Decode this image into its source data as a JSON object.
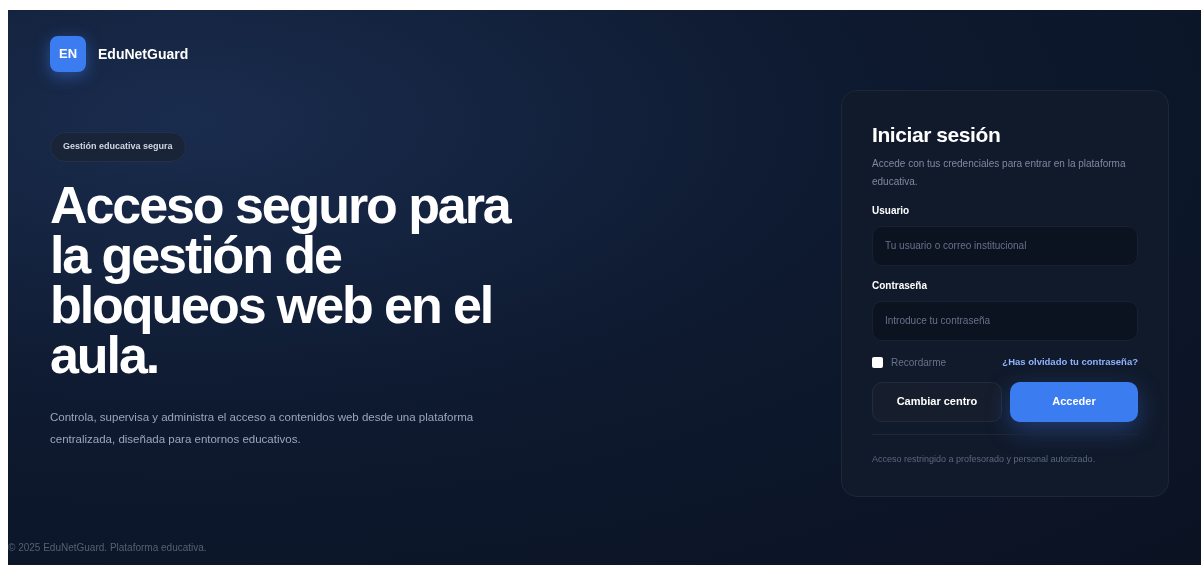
{
  "brand": {
    "logo": "EN",
    "name": "EduNetGuard"
  },
  "hero": {
    "badge": "Gestión educativa segura",
    "headline": "Acceso seguro para la gestión de bloqueos web en el aula.",
    "description": "Controla, supervisa y administra el acceso a contenidos web desde una plataforma centralizada, diseñada para entornos educativos."
  },
  "footer": "© 2025 EduNetGuard. Plataforma educativa.",
  "login": {
    "title": "Iniciar sesión",
    "subtitle": "Accede con tus credenciales para entrar en la plataforma educativa.",
    "fields": [
      {
        "label": "Usuario",
        "placeholder": "Tu usuario o correo institucional"
      },
      {
        "label": "Contraseña",
        "placeholder": "Introduce tu contraseña"
      }
    ],
    "remember": {
      "label": "Recordarme",
      "checked": false
    },
    "forgot_link": "¿Has olvidado tu contraseña?",
    "buttons": [
      {
        "label": "Cambiar centro",
        "kind": "secondary"
      },
      {
        "label": "Acceder",
        "kind": "primary"
      }
    ],
    "notice": "Acceso restringido a profesorado y personal autorizado."
  }
}
